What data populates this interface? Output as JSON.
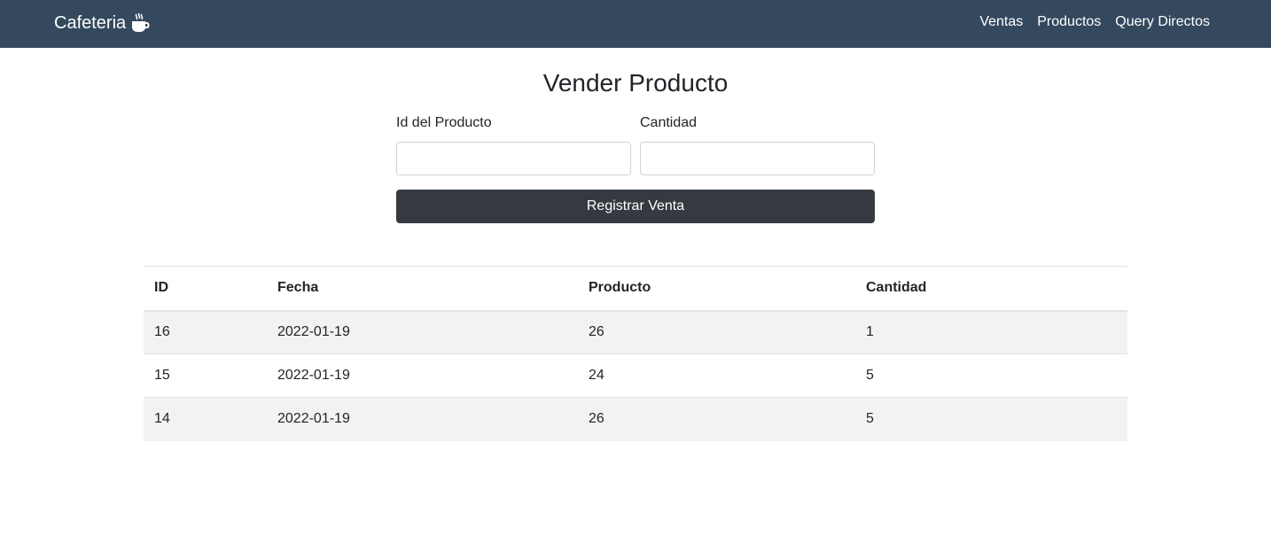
{
  "navbar": {
    "brand": "Cafeteria",
    "links": [
      "Ventas",
      "Productos",
      "Query Directos"
    ]
  },
  "form": {
    "title": "Vender Producto",
    "product_id_label": "Id del Producto",
    "product_id_value": "",
    "quantity_label": "Cantidad",
    "quantity_value": "",
    "submit_label": "Registrar Venta"
  },
  "table": {
    "headers": [
      "ID",
      "Fecha",
      "Producto",
      "Cantidad"
    ],
    "rows": [
      [
        "16",
        "2022-01-19",
        "26",
        "1"
      ],
      [
        "15",
        "2022-01-19",
        "24",
        "5"
      ],
      [
        "14",
        "2022-01-19",
        "26",
        "5"
      ]
    ]
  },
  "colors": {
    "navbar_bg": "#34495e",
    "button_bg": "#343a40",
    "stripe_bg": "#f2f2f2"
  },
  "icons": {
    "brand_icon": "coffee-cup-icon"
  }
}
